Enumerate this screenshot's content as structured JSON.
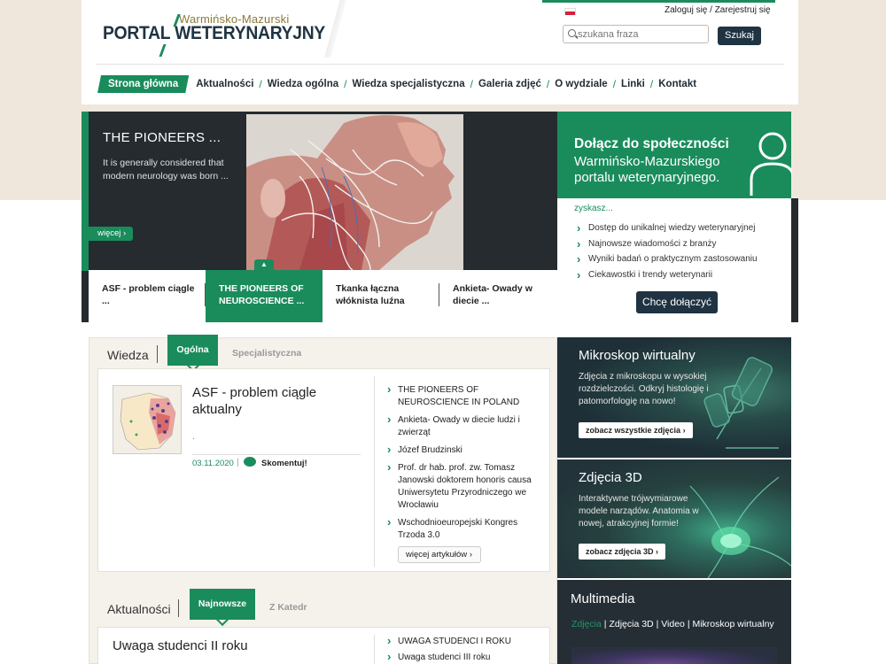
{
  "header": {
    "logo_small": "Warmińsko-Mazurski",
    "logo_big": "PORTAL WETERYNARYJNY",
    "login": "Zaloguj się",
    "auth_sep": "/",
    "register": "Zarejestruj się",
    "search_placeholder": "szukana fraza",
    "search_button": "Szukaj"
  },
  "nav": {
    "items": [
      "Strona główna",
      "Aktualności",
      "Wiedza ogólna",
      "Wiedza specjalistyczna",
      "Galeria zdjęć",
      "O wydziale",
      "Linki",
      "Kontakt"
    ],
    "separator": "/"
  },
  "hero": {
    "title": "THE PIONEERS ...",
    "text": "It is generally considered that modern neurology was born ...",
    "more": "więcej",
    "tabs": [
      {
        "label": "ASF - problem ciągle ..."
      },
      {
        "label": "THE PIONEERS OF NEUROSCIENCE ..."
      },
      {
        "label": "Tkanka łączna włóknista luźna"
      },
      {
        "label": "Ankieta- Owady w diecie ..."
      }
    ]
  },
  "join": {
    "title": "Dołącz do społeczności",
    "subtitle": "Warmińsko-Mazurskiego portalu weterynaryjnego.",
    "zyskasz": "zyskasz...",
    "items": [
      "Dostęp do unikalnej wiedzy weterynaryjnej",
      "Najnowsze wiadomości z branży",
      "Wyniki badań o praktycznym zastosowaniu",
      "Ciekawostki i trendy weterynarii"
    ],
    "button": "Chcę dołączyć"
  },
  "wiedza": {
    "label": "Wiedza",
    "tab_active": "Ogólna",
    "tab_inactive": "Specjalistyczna",
    "article_title": "ASF - problem ciągle aktualny",
    "article_excerpt": ".",
    "article_date": "03.11.2020",
    "date_sep": "|",
    "comment": "Skomentuj!",
    "list": [
      "THE PIONEERS OF NEUROSCIENCE IN POLAND",
      "Ankieta- Owady w diecie ludzi i zwierząt",
      "Józef Brudzinski",
      "Prof. dr hab. prof. zw. Tomasz Janowski doktorem honoris causa Uniwersytetu Przyrodniczego we Wrocławiu",
      "Wschodnioeuropejski Kongres Trzoda 3.0"
    ],
    "more_button": "więcej artykułów"
  },
  "aktualnosci": {
    "label": "Aktualności",
    "tab_active": "Najnowsze",
    "tab_inactive": "Z Katedr",
    "article_title": "Uwaga studenci II roku",
    "list": [
      "UWAGA STUDENCI I ROKU",
      "Uwaga studenci III roku"
    ]
  },
  "side": {
    "mikro": {
      "title": "Mikroskop wirtualny",
      "text": "Zdjęcia z mikroskopu w wysokiej rozdzielczości. Odkryj histologię i patomorfologię na nowo!",
      "button": "zobacz wszystkie zdjęcia"
    },
    "d3": {
      "title": "Zdjęcia 3D",
      "text": "Interaktywne trójwymiarowe modele narządów. Anatomia w nowej, atrakcyjnej formie!",
      "button": "zobacz zdjęcia 3D"
    },
    "multi": {
      "title": "Multimedia",
      "links": [
        "Zdjęcia",
        "Zdjęcia 3D",
        "Video",
        "Mikroskop wirtualny"
      ],
      "link_sep": "|"
    }
  },
  "colors": {
    "brand_green": "#1a8c5c",
    "dark_navy": "#1f3342",
    "dark_panel": "#252b2f",
    "beige_bg": "#efe7dc"
  },
  "icons": [
    "search-icon",
    "flag-pl-icon",
    "chevron-right-icon",
    "chevron-up-icon",
    "chevron-down-icon",
    "comment-bubble-icon",
    "user-silhouette-icon"
  ]
}
